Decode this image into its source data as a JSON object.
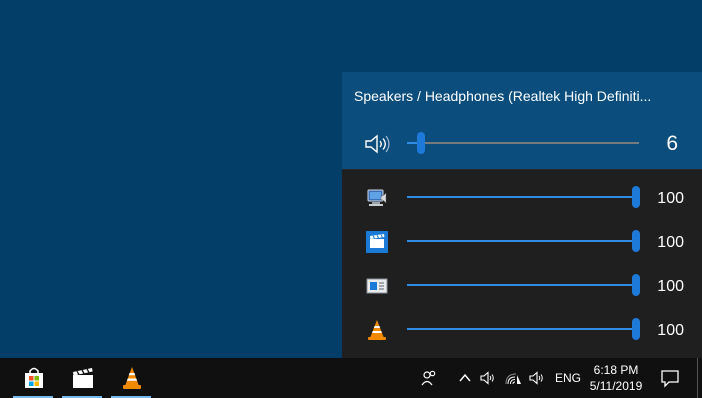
{
  "flyout": {
    "device_name": "Speakers / Headphones (Realtek High Definiti...",
    "master_volume": 6,
    "master_volume_label": "6",
    "apps": [
      {
        "icon": "system-sounds-icon",
        "volume": 100,
        "volume_label": "100"
      },
      {
        "icon": "movies-tv-icon",
        "volume": 100,
        "volume_label": "100"
      },
      {
        "icon": "news-app-icon",
        "volume": 100,
        "volume_label": "100"
      },
      {
        "icon": "vlc-icon",
        "volume": 100,
        "volume_label": "100"
      }
    ]
  },
  "taskbar": {
    "pinned": [
      "microsoft-store-icon",
      "movies-tv-icon",
      "vlc-icon"
    ],
    "tray": {
      "language": "ENG",
      "time": "6:18 PM",
      "date": "5/11/2019"
    }
  },
  "colors": {
    "desktop": "#023e68",
    "device_panel": "#0b4e7d",
    "flyout_bg": "#1f1f1f",
    "accent": "#1e7ad8",
    "taskbar": "#101010"
  }
}
